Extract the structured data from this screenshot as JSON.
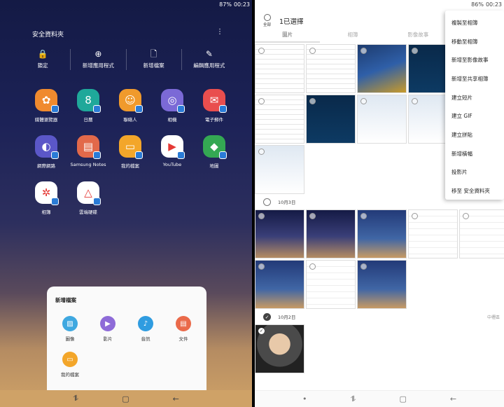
{
  "left": {
    "status": {
      "battery": "87%",
      "time": "00:23"
    },
    "title": "安全資料夾",
    "more_icon": "⋮",
    "toolbar": [
      {
        "icon": "lock-icon",
        "glyph": "🔒",
        "label": "鎖定"
      },
      {
        "icon": "plus-circle-icon",
        "glyph": "⊕",
        "label": "新增應用程式"
      },
      {
        "icon": "file-icon",
        "glyph": "🗋",
        "label": "新增檔案"
      },
      {
        "icon": "pencil-icon",
        "glyph": "✎",
        "label": "編輯應用程式"
      }
    ],
    "apps": [
      {
        "label": "媒體瀏覽器",
        "color": "#f08a2e",
        "glyph": "✿"
      },
      {
        "label": "日曆",
        "color": "#1fa89a",
        "glyph": "8"
      },
      {
        "label": "聯絡人",
        "color": "#f09a2c",
        "glyph": "☺"
      },
      {
        "label": "相機",
        "color": "#7b69d6",
        "glyph": "◎"
      },
      {
        "label": "電子郵件",
        "color": "#e94e4e",
        "glyph": "✉"
      },
      {
        "label": "網際網路",
        "color": "#5b57c8",
        "glyph": "◐"
      },
      {
        "label": "Samsung Notes",
        "color": "#e2694a",
        "glyph": "▤"
      },
      {
        "label": "我的檔案",
        "color": "#f3a62a",
        "glyph": "▭"
      },
      {
        "label": "YouTube",
        "color": "#ffffff",
        "glyph": "▶"
      },
      {
        "label": "地圖",
        "color": "#34a853",
        "glyph": "◆"
      },
      {
        "label": "相簿",
        "color": "#ffffff",
        "glyph": "✲"
      },
      {
        "label": "雲端硬碟",
        "color": "#ffffff",
        "glyph": "△"
      }
    ],
    "sheet": {
      "title": "新增檔案",
      "items": [
        {
          "label": "圖像",
          "color": "#3fa8e0",
          "glyph": "▨",
          "icon": "image-icon"
        },
        {
          "label": "影片",
          "color": "#8e6bd8",
          "glyph": "▶",
          "icon": "video-icon"
        },
        {
          "label": "音訊",
          "color": "#2f9ce0",
          "glyph": "♪",
          "icon": "audio-icon"
        },
        {
          "label": "文件",
          "color": "#ea6a4a",
          "glyph": "▤",
          "icon": "document-icon"
        },
        {
          "label": "我的檔案",
          "color": "#f3a62a",
          "glyph": "▭",
          "icon": "folder-icon"
        }
      ]
    },
    "nav": {
      "recent": "⥮",
      "home": "▢",
      "back": "←"
    }
  },
  "right": {
    "status": {
      "battery": "86%",
      "time": "00:23"
    },
    "select_all_label": "全部",
    "selected_count": "1已選擇",
    "tabs": [
      "圖片",
      "相簿",
      "影像故事"
    ],
    "groups": [
      {
        "date": "",
        "thumbs": [
          "tdoc",
          "tdoc",
          "tgame",
          "tdark",
          "tdoc",
          "tdoc",
          "tdark",
          "tdlg",
          "tdlg",
          "tdlg",
          "tdlg"
        ]
      },
      {
        "date": "10月3日",
        "thumbs": [
          "tphone",
          "tphone",
          "tlock",
          "tset",
          "tset",
          "tlock",
          "tset",
          "tlock"
        ]
      },
      {
        "date": "10月2日",
        "location": "中壢區",
        "thumbs": [
          "tphoto"
        ],
        "checked": true
      }
    ],
    "menu": [
      "複製至相簿",
      "移動至相簿",
      "新增至影像故事",
      "新增至共享相簿",
      "建立短片",
      "建立 GIF",
      "建立拼貼",
      "新增橫幅",
      "投影片",
      "移至 安全資料夾"
    ],
    "nav": {
      "dot": "•",
      "recent": "⥮",
      "home": "▢",
      "back": "←"
    }
  }
}
